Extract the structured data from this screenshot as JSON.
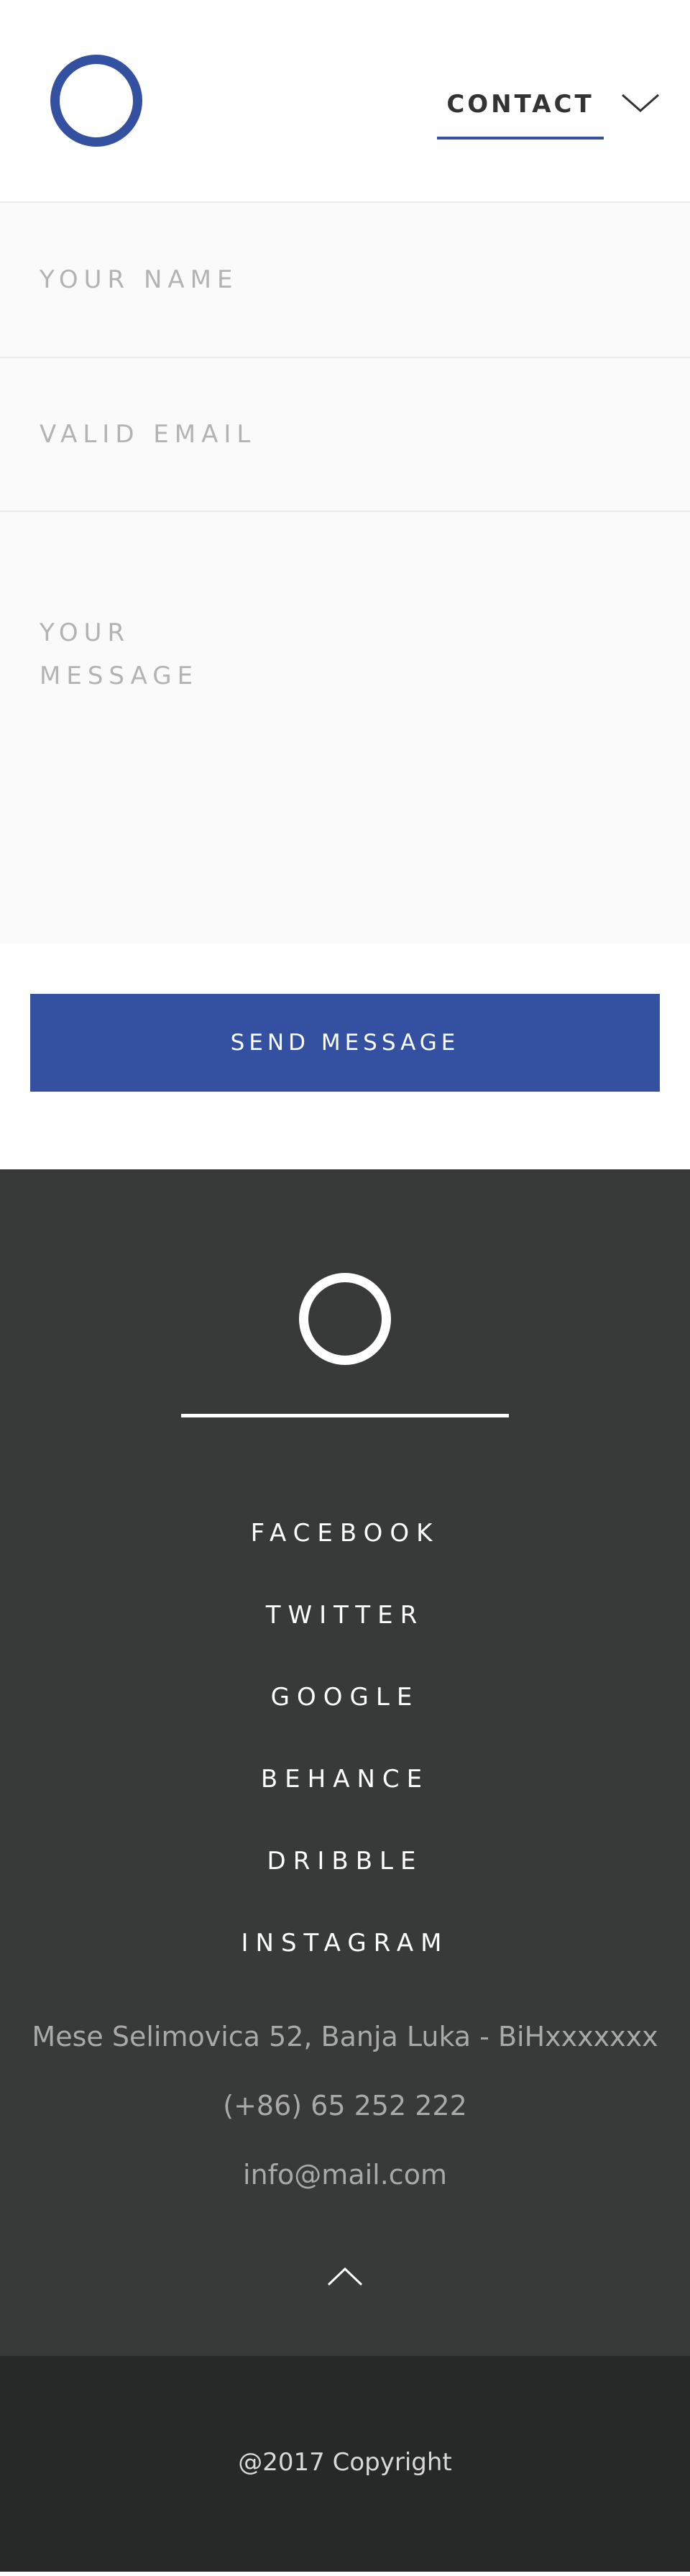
{
  "header": {
    "nav_label": "CONTACT"
  },
  "form": {
    "name_placeholder": "YOUR NAME",
    "email_placeholder": "VALID EMAIL",
    "message_placeholder": "YOUR MESSAGE",
    "submit_label": "SEND MESSAGE"
  },
  "footer": {
    "social": [
      "FACEBOOK",
      "TWITTER",
      "GOOGLE",
      "BEHANCE",
      "DRIBBLE",
      "INSTAGRAM"
    ],
    "address": "Mese Selimovica 52, Banja Luka - BiHxxxxxxx",
    "phone": "(+86) 65 252 222",
    "email": "info@mail.com",
    "copyright": "@2017 Copyright"
  },
  "colors": {
    "accent": "#3450a0",
    "footer_bg": "#383939",
    "copyright_bg": "#272828",
    "form_bg": "#fafafa"
  },
  "icons": {
    "logo": "ring-logo-icon",
    "nav_toggle": "chevron-down-icon",
    "back_to_top": "chevron-up-icon"
  }
}
